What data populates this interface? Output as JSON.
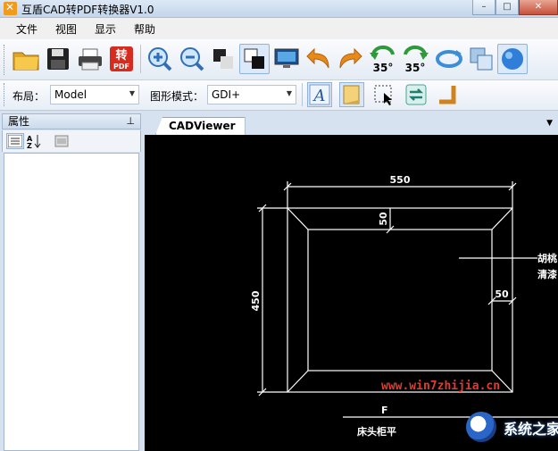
{
  "window": {
    "title": "互盾CAD转PDF转换器V1.0",
    "controls": {
      "minimize": "–",
      "maximize": "□",
      "close": "✕"
    }
  },
  "menu": {
    "items": [
      "文件",
      "视图",
      "显示",
      "帮助"
    ]
  },
  "toolbar": {
    "rotate_left_label": "35°",
    "rotate_right_label": "35°",
    "convert_text": "转",
    "convert_sub": "PDF"
  },
  "toolbar2": {
    "layout_label": "布局：",
    "layout_value": "Model",
    "render_label": "图形模式：",
    "render_value": "GDI+"
  },
  "properties_panel": {
    "title": "属性",
    "pin": "ꟷ"
  },
  "document": {
    "tab_label": "CADViewer",
    "tab_menu": "▼"
  },
  "drawing": {
    "dim_width": "550",
    "dim_height": "450",
    "dim_top_inset": "50",
    "dim_side_inset": "50",
    "note_line1": "胡桃",
    "note_line2": "清漆",
    "caption": "床头柜平",
    "caption_prefix": "F",
    "colors": {
      "line": "#ffffff",
      "background": "#000000"
    }
  },
  "watermark": {
    "url": "www.win7zhijia.cn",
    "brand": "系统之家"
  }
}
